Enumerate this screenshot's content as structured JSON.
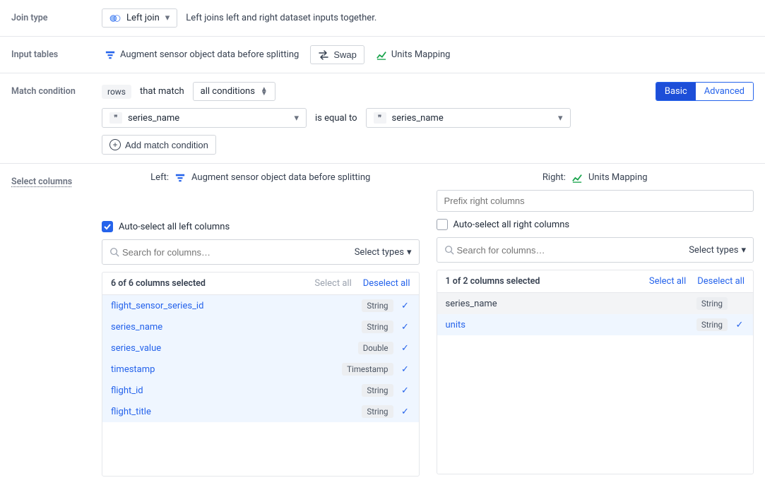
{
  "join": {
    "label": "Join type",
    "type_label": "Left join",
    "description": "Left joins left and right dataset inputs together."
  },
  "input_tables": {
    "label": "Input tables",
    "left_name": "Augment sensor object data before splitting",
    "swap_label": "Swap",
    "right_name": "Units Mapping"
  },
  "match": {
    "label": "Match condition",
    "rows_chip": "rows",
    "that_match": "that match",
    "scope_label": "all conditions",
    "left_field": "series_name",
    "operator": "is equal to",
    "right_field": "series_name",
    "add_label": "Add match condition",
    "mode_basic": "Basic",
    "mode_advanced": "Advanced"
  },
  "select": {
    "label": "Select columns",
    "left_title_prefix": "Left:",
    "left_title": "Augment sensor object data before splitting",
    "right_title_prefix": "Right:",
    "right_title": "Units Mapping",
    "prefix_placeholder": "Prefix right columns",
    "auto_left": "Auto-select all left columns",
    "auto_right": "Auto-select all right columns",
    "search_placeholder": "Search for columns…",
    "select_types": "Select types",
    "select_all": "Select all",
    "deselect_all": "Deselect all",
    "left_count": "6 of 6 columns selected",
    "right_count": "1 of 2 columns selected",
    "left_columns": [
      {
        "name": "flight_sensor_series_id",
        "type": "String",
        "selected": true
      },
      {
        "name": "series_name",
        "type": "String",
        "selected": true
      },
      {
        "name": "series_value",
        "type": "Double",
        "selected": true
      },
      {
        "name": "timestamp",
        "type": "Timestamp",
        "selected": true
      },
      {
        "name": "flight_id",
        "type": "String",
        "selected": true
      },
      {
        "name": "flight_title",
        "type": "String",
        "selected": true
      }
    ],
    "right_columns": [
      {
        "name": "series_name",
        "type": "String",
        "selected": false
      },
      {
        "name": "units",
        "type": "String",
        "selected": true
      }
    ]
  }
}
